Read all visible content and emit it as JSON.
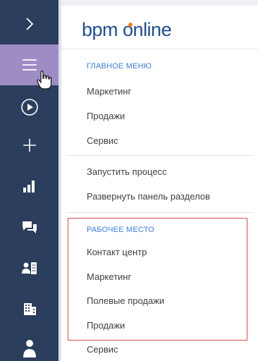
{
  "sidebar": {
    "buttons": [
      {
        "icon": "chevron-right-icon"
      },
      {
        "icon": "hamburger-menu-icon",
        "active": true
      },
      {
        "icon": "play-circle-icon"
      },
      {
        "icon": "plus-icon"
      },
      {
        "icon": "bar-chart-icon"
      },
      {
        "icon": "chat-icon"
      },
      {
        "icon": "contact-card-icon"
      },
      {
        "icon": "building-icon"
      },
      {
        "icon": "user-icon"
      }
    ],
    "active_color": "#9e8cc5",
    "bg_color": "#2c3e5d"
  },
  "panel": {
    "logo_text": "bpm'online",
    "logo_part1": "bpm",
    "logo_part2": "online",
    "main_menu": {
      "title": "ГЛАВНОЕ МЕНЮ",
      "items": [
        "Маркетинг",
        "Продажи",
        "Сервис"
      ]
    },
    "actions": {
      "items": [
        "Запустить процесс",
        "Развернуть панель разделов"
      ]
    },
    "workplace": {
      "title": "РАБОЧЕЕ МЕСТО",
      "items": [
        "Контакт центр",
        "Маркетинг",
        "Полевые продажи",
        "Продажи",
        "Сервис"
      ]
    }
  },
  "colors": {
    "section_title": "#3a7fd5",
    "highlight_border": "#e04a4a",
    "logo": "#1f4e8c",
    "logo_dot": "#f58220"
  }
}
